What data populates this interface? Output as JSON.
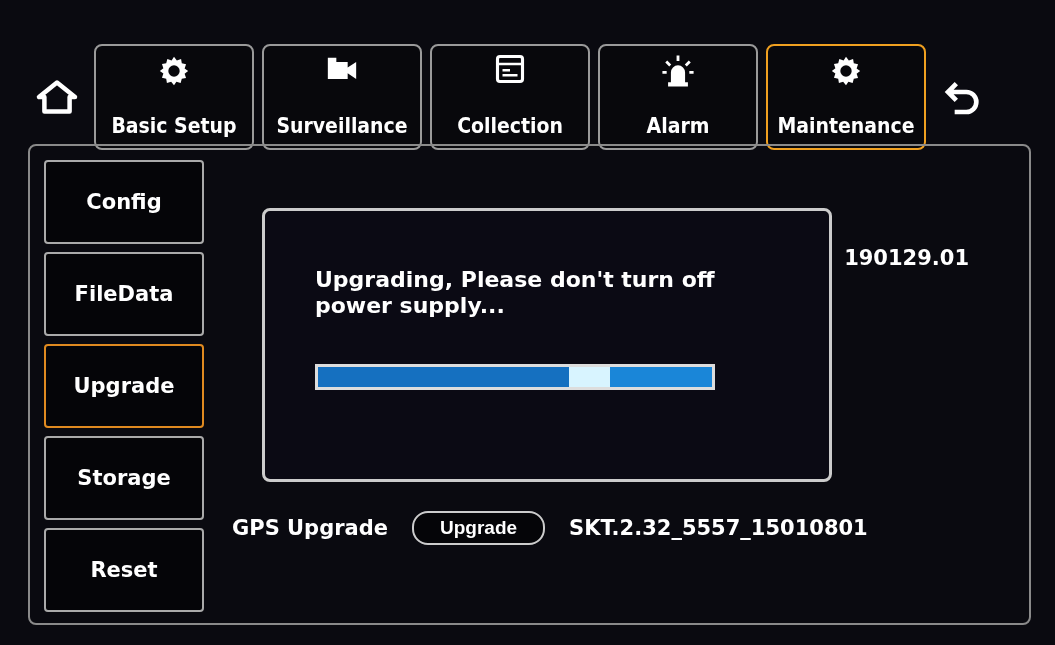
{
  "tabs": [
    {
      "label": "Basic Setup",
      "selected": false
    },
    {
      "label": "Surveillance",
      "selected": false
    },
    {
      "label": "Collection",
      "selected": false
    },
    {
      "label": "Alarm",
      "selected": false
    },
    {
      "label": "Maintenance",
      "selected": true
    }
  ],
  "sidebar": {
    "items": [
      {
        "label": "Config",
        "selected": false
      },
      {
        "label": "FileData",
        "selected": false
      },
      {
        "label": "Upgrade",
        "selected": true
      },
      {
        "label": "Storage",
        "selected": false
      },
      {
        "label": "Reset",
        "selected": false
      }
    ]
  },
  "upgrade_rows": {
    "first_value": "190129.01",
    "last_row": {
      "label": "GPS Upgrade",
      "button": "Upgrade",
      "value": "SKT.2.32_5557_15010801"
    }
  },
  "dialog": {
    "message": "Upgrading, Please don't turn off power supply...",
    "progress": {
      "level": 0.74
    }
  }
}
